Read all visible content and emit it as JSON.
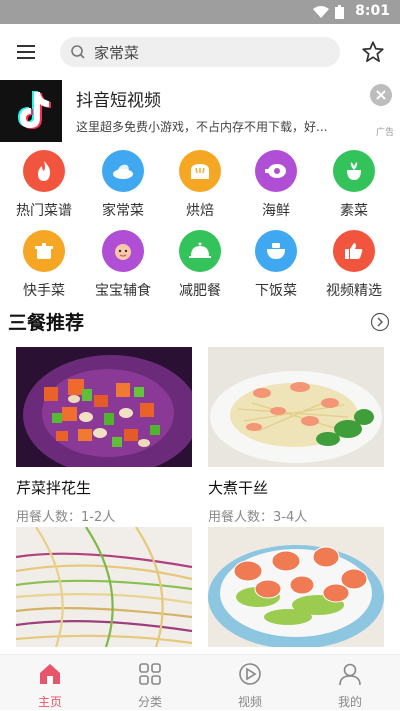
{
  "status": {
    "time": "8:01"
  },
  "search": {
    "value": "家常菜"
  },
  "ad": {
    "title": "抖音短视频",
    "desc": "这里超多免费小游戏，不占内存不用下载，好...",
    "tag": "广告"
  },
  "categories": [
    {
      "label": "热门菜谱",
      "icon": "fire-icon",
      "color": "#f2553d"
    },
    {
      "label": "家常菜",
      "icon": "dish-icon",
      "color": "#3fa8f0"
    },
    {
      "label": "烘焙",
      "icon": "bread-icon",
      "color": "#f5a623"
    },
    {
      "label": "海鲜",
      "icon": "ham-icon",
      "color": "#b04ed6"
    },
    {
      "label": "素菜",
      "icon": "vegetable-icon",
      "color": "#34c35b"
    },
    {
      "label": "快手菜",
      "icon": "pot-icon",
      "color": "#f5a623"
    },
    {
      "label": "宝宝辅食",
      "icon": "baby-icon",
      "color": "#b04ed6"
    },
    {
      "label": "减肥餐",
      "icon": "cloche-icon",
      "color": "#34c35b"
    },
    {
      "label": "下饭菜",
      "icon": "bowl-icon",
      "color": "#3fa8f0"
    },
    {
      "label": "视频精选",
      "icon": "thumbs-up-icon",
      "color": "#f2553d"
    }
  ],
  "section": {
    "title": "三餐推荐"
  },
  "recipes": [
    {
      "name": "芹菜拌花生",
      "meta": "用餐人数：1-2人"
    },
    {
      "name": "大煮干丝",
      "meta": "用餐人数：3-4人"
    },
    {
      "name": "",
      "meta": ""
    },
    {
      "name": "",
      "meta": ""
    }
  ],
  "tabs": [
    {
      "label": "主页",
      "icon": "home-icon"
    },
    {
      "label": "分类",
      "icon": "grid-icon"
    },
    {
      "label": "视频",
      "icon": "play-icon"
    },
    {
      "label": "我的",
      "icon": "user-icon"
    }
  ],
  "colors": {
    "accent": "#e8546b",
    "statusbar": "#9e9e9e"
  }
}
